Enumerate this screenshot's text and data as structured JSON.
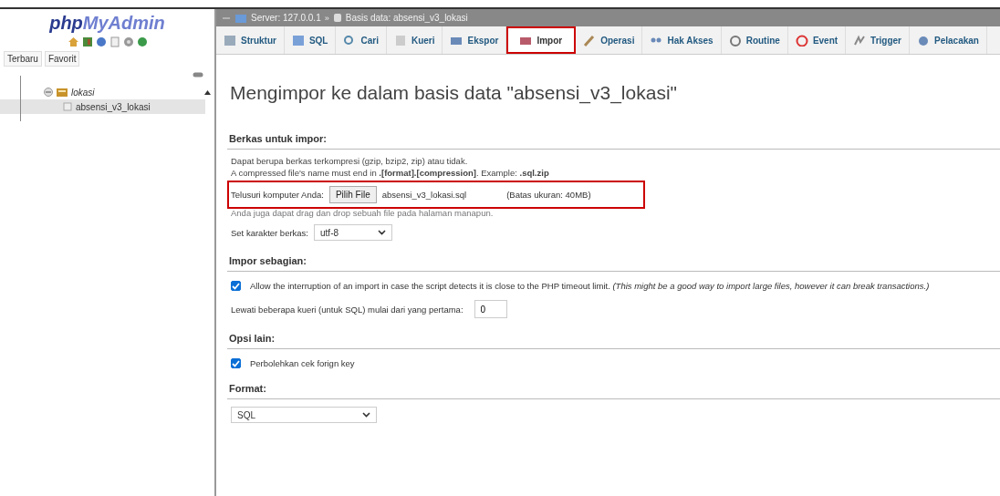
{
  "sidebar": {
    "logo_parts": [
      "php",
      "MyAdmin"
    ],
    "tabs": [
      {
        "label": "Terbaru",
        "selected": false
      },
      {
        "label": "Favorit",
        "selected": false
      }
    ],
    "tree": [
      {
        "label": "lokasi",
        "expanded": true,
        "selected": false,
        "children": [
          {
            "label": "absensi_v3_lokasi",
            "selected": true
          }
        ]
      }
    ]
  },
  "breadcrumb": {
    "server": "Server: 127.0.0.1",
    "separator": "»",
    "database": "Basis data: absensi_v3_lokasi"
  },
  "tabs": [
    {
      "label": "Struktur",
      "kind": "struct",
      "selected": false,
      "highlighted": false
    },
    {
      "label": "SQL",
      "kind": "sql",
      "selected": false,
      "highlighted": false
    },
    {
      "label": "Cari",
      "kind": "search",
      "selected": false,
      "highlighted": false
    },
    {
      "label": "Kueri",
      "kind": "query",
      "selected": false,
      "highlighted": false
    },
    {
      "label": "Ekspor",
      "kind": "export",
      "selected": false,
      "highlighted": false
    },
    {
      "label": "Impor",
      "kind": "import",
      "selected": true,
      "highlighted": true
    },
    {
      "label": "Operasi",
      "kind": "ops",
      "selected": false,
      "highlighted": false
    },
    {
      "label": "Hak Akses",
      "kind": "priv",
      "selected": false,
      "highlighted": false
    },
    {
      "label": "Routine",
      "kind": "routine",
      "selected": false,
      "highlighted": false
    },
    {
      "label": "Event",
      "kind": "event",
      "selected": false,
      "highlighted": false
    },
    {
      "label": "Trigger",
      "kind": "trigger",
      "selected": false,
      "highlighted": false
    },
    {
      "label": "Pelacakan",
      "kind": "track",
      "selected": false,
      "highlighted": false
    }
  ],
  "heading": "Mengimpor ke dalam basis data \"absensi_v3_lokasi\"",
  "file_section": {
    "title": "Berkas untuk impor:",
    "notes": [
      "Dapat berupa berkas terkompresi (gzip, bzip2, zip) atau tidak.",
      "A compressed file's name must end in **.[format].[compression]**. Example: **.sql.zip**"
    ],
    "browse_label": "Telusuri komputer Anda:",
    "browse_button": "Pilih File",
    "file_name": "absensi_v3_lokasi.sql",
    "size_limit": "(Batas ukuran: 40MB)",
    "highlighted": true,
    "drag_note": "Anda juga dapat drag dan drop sebuah file pada halaman manapun.",
    "charset_label": "Set karakter berkas:",
    "charset": "utf-8"
  },
  "partial_section": {
    "title": "Impor sebagian:",
    "allow_interrupt": {
      "checked": true,
      "label": "Allow the interruption of an import in case the script detects it is close to the PHP timeout limit. *(This might be a good way to import large files, however it can break transactions.)*"
    },
    "skip_label": "Lewati beberapa kueri (untuk SQL) mulai dari yang pertama:",
    "skip_value": "0"
  },
  "other_section": {
    "title": "Opsi lain:",
    "foreign_key": {
      "checked": true,
      "label": "Perbolehkan cek forign key"
    }
  },
  "format_section": {
    "title": "Format:",
    "format": "SQL"
  }
}
